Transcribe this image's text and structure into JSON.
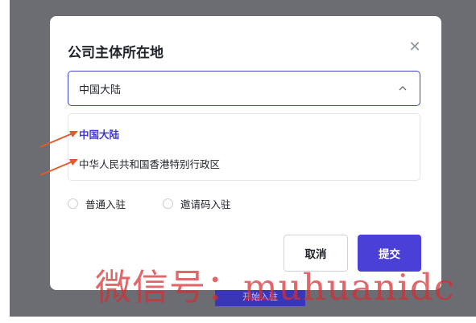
{
  "dialog": {
    "title": "公司主体所在地",
    "close_icon": "close-icon",
    "select": {
      "value": "中国大陆",
      "chevron_icon": "chevron-up-icon"
    },
    "options": [
      {
        "label": "中国大陆",
        "selected": true
      },
      {
        "label": "中华人民共和国香港特别行政区",
        "selected": false
      }
    ],
    "radios": [
      {
        "label": "普通入驻",
        "checked": false
      },
      {
        "label": "邀请码入驻",
        "checked": false
      }
    ],
    "buttons": {
      "cancel": "取消",
      "submit": "提交"
    }
  },
  "background": {
    "button_label": "开始入驻"
  },
  "watermark": "微信号：muhuanidc",
  "colors": {
    "accent": "#4a3fd6",
    "selected_text": "#4038cf",
    "annotation_arrow": "#e35a2a",
    "overlay": "#6b6d73"
  }
}
